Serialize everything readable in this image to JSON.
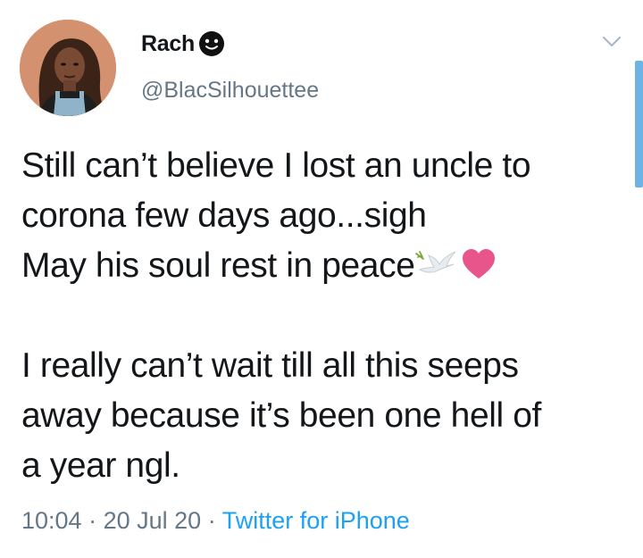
{
  "author": {
    "display_name": "Rach",
    "handle": "@BlacSilhouettee"
  },
  "tweet": {
    "line1": "Still can’t believe I lost an uncle to",
    "line2": "corona few days ago...sigh",
    "line3": "May his soul rest in peace",
    "para2_line1": "I really can’t wait till all this seeps",
    "para2_line2": "away because it’s been one hell of",
    "para2_line3": "a year ngl."
  },
  "meta": {
    "time": "10:04",
    "separator": "·",
    "date": "20 Jul 20",
    "source": "Twitter for iPhone"
  },
  "colors": {
    "text": "#14171a",
    "secondary": "#657786",
    "link": "#1da1f2",
    "scrollbar": "#6db3e4",
    "avatar_bg": "#d4916f",
    "heart": "#e8558a"
  },
  "icons": {
    "name_emoji": "face-emoji-icon",
    "caret": "chevron-down-icon",
    "dove": "dove-emoji-icon",
    "heart": "pink-heart-emoji-icon"
  }
}
